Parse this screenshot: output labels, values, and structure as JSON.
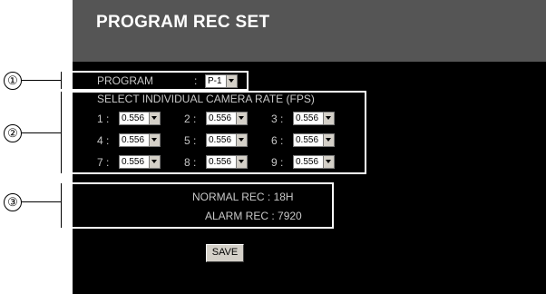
{
  "header": {
    "title": "PROGRAM REC SET"
  },
  "callouts": [
    "①",
    "②",
    "③"
  ],
  "program": {
    "label": "PROGRAM",
    "colon": ":",
    "value": "P-1"
  },
  "camera_rate": {
    "title": "SELECT INDIVIDUAL CAMERA RATE (FPS)",
    "cameras": [
      {
        "num": "1 :",
        "value": "0.556"
      },
      {
        "num": "2 :",
        "value": "0.556"
      },
      {
        "num": "3 :",
        "value": "0.556"
      },
      {
        "num": "4 :",
        "value": "0.556"
      },
      {
        "num": "5 :",
        "value": "0.556"
      },
      {
        "num": "6 :",
        "value": "0.556"
      },
      {
        "num": "7 :",
        "value": "0.556"
      },
      {
        "num": "8 :",
        "value": "0.556"
      },
      {
        "num": "9 :",
        "value": "0.556"
      }
    ]
  },
  "rec_info": {
    "normal": "NORMAL REC : 18H",
    "alarm": "ALARM REC : 7920"
  },
  "save_label": "SAVE"
}
